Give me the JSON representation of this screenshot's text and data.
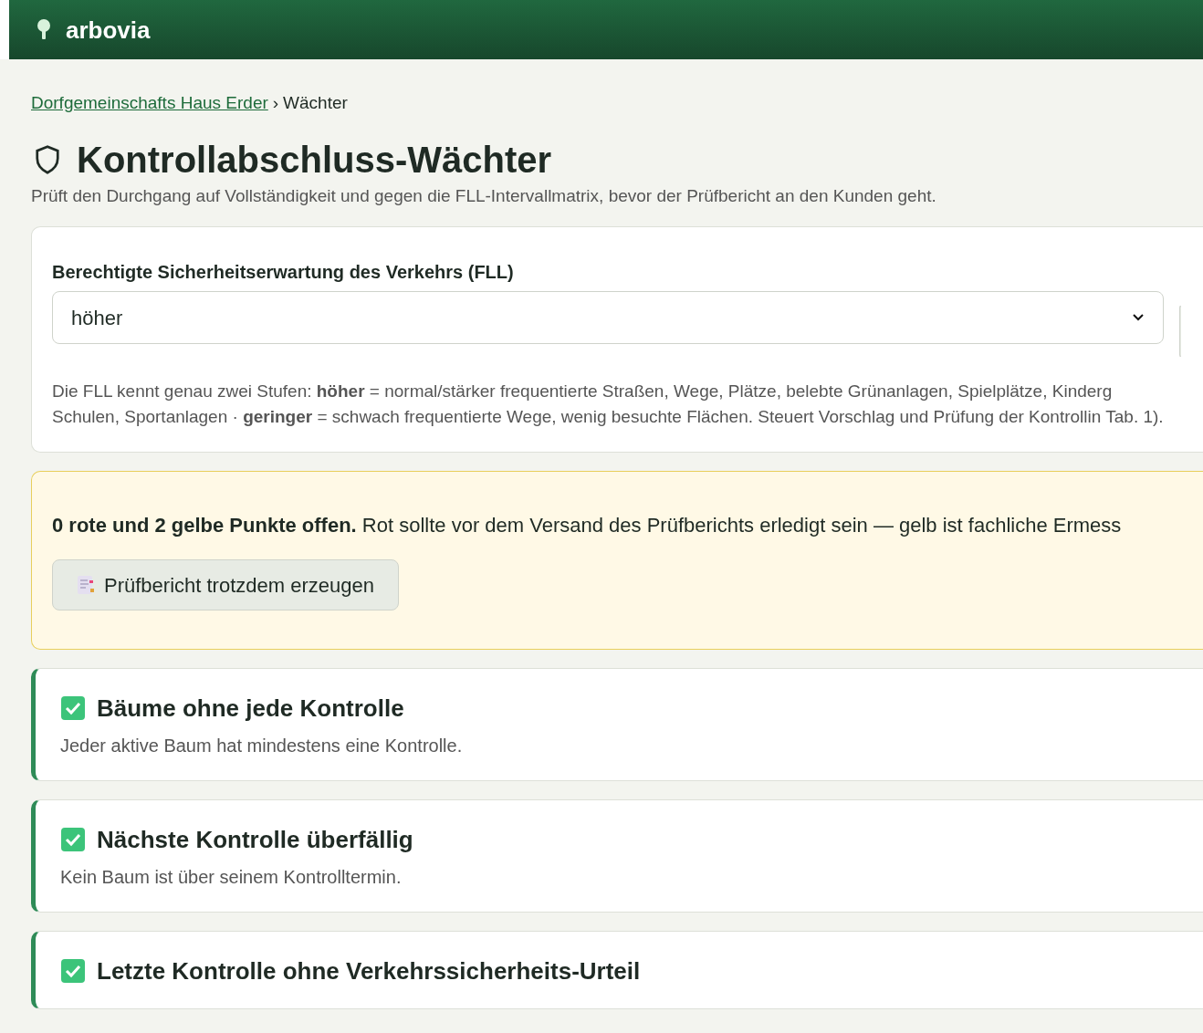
{
  "app": {
    "name": "arbovia"
  },
  "breadcrumb": {
    "link": "Dorfgemeinschafts Haus Erder",
    "separator": "›",
    "current": "Wächter"
  },
  "page": {
    "title": "Kontrollabschluss-Wächter",
    "subtitle": "Prüft den Durchgang auf Vollständigkeit und gegen die FLL-Intervallmatrix, bevor der Prüfbericht an den Kunden geht."
  },
  "expectation": {
    "label": "Berechtigte Sicherheitserwartung des Verkehrs (FLL)",
    "value": "höher",
    "hint": "Die FLL kennt genau zwei Stufen: **höher** = normal/stärker frequentierte Straßen, Wege, Plätze, belebte Grünanlagen, Spielplätze, Kinderg Schulen, Sportanlagen · **geringer** = schwach frequentierte Wege, wenig besuchte Flächen. Steuert Vorschlag und Prüfung der Kontrollin Tab. 1)."
  },
  "summary": {
    "text": "**0 rote und 2 gelbe Punkte offen.** Rot sollte vor dem Versand des Prüfberichts erledigt sein — gelb ist fachliche Ermess",
    "button": "Prüfbericht trotzdem erzeugen"
  },
  "checks": [
    {
      "passed": true,
      "title": "Bäume ohne jede Kontrolle",
      "description": "Jeder aktive Baum hat mindestens eine Kontrolle."
    },
    {
      "passed": true,
      "title": "Nächste Kontrolle überfällig",
      "description": "Kein Baum ist über seinem Kontrolltermin."
    },
    {
      "passed": true,
      "title": "Letzte Kontrolle ohne Verkehrssicherheits-Urteil"
    }
  ]
}
